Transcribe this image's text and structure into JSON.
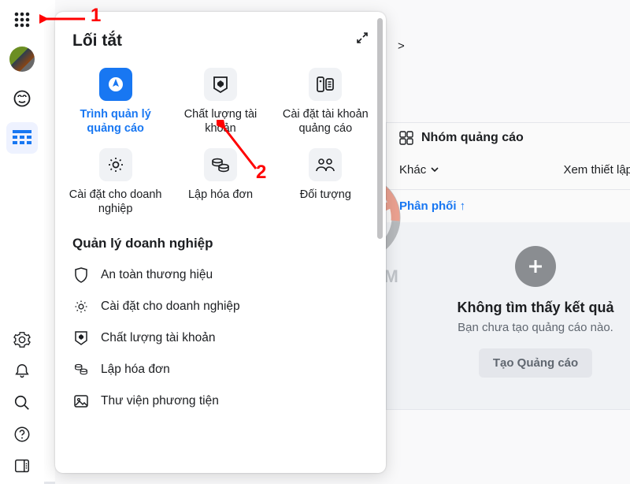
{
  "annotations": {
    "num1": "1",
    "num2": "2"
  },
  "watermark_text": "MOA VIỆT NAM",
  "panel": {
    "title": "Lối tắt",
    "shortcuts": [
      {
        "label": "Trình quản lý quảng cáo"
      },
      {
        "label": "Chất lượng tài khoản"
      },
      {
        "label": "Cài đặt tài khoản quảng cáo"
      },
      {
        "label": "Cài đặt cho doanh nghiệp"
      },
      {
        "label": "Lập hóa đơn"
      },
      {
        "label": "Đối tượng"
      }
    ],
    "section_title": "Quản lý doanh nghiệp",
    "list": [
      "An toàn thương hiệu",
      "Cài đặt cho doanh nghiệp",
      "Chất lượng tài khoản",
      "Lập hóa đơn",
      "Thư viện phương tiện"
    ]
  },
  "crumb_trail": ">",
  "card": {
    "title": "Nhóm quảng cáo",
    "dropdown": "Khác",
    "toggle_label": "Xem thiết lập",
    "sort_label": "Phân phối",
    "sort_arrow": "↑"
  },
  "empty": {
    "title": "Không tìm thấy kết quả",
    "subtitle": "Bạn chưa tạo quảng cáo nào.",
    "button": "Tạo Quảng cáo"
  }
}
